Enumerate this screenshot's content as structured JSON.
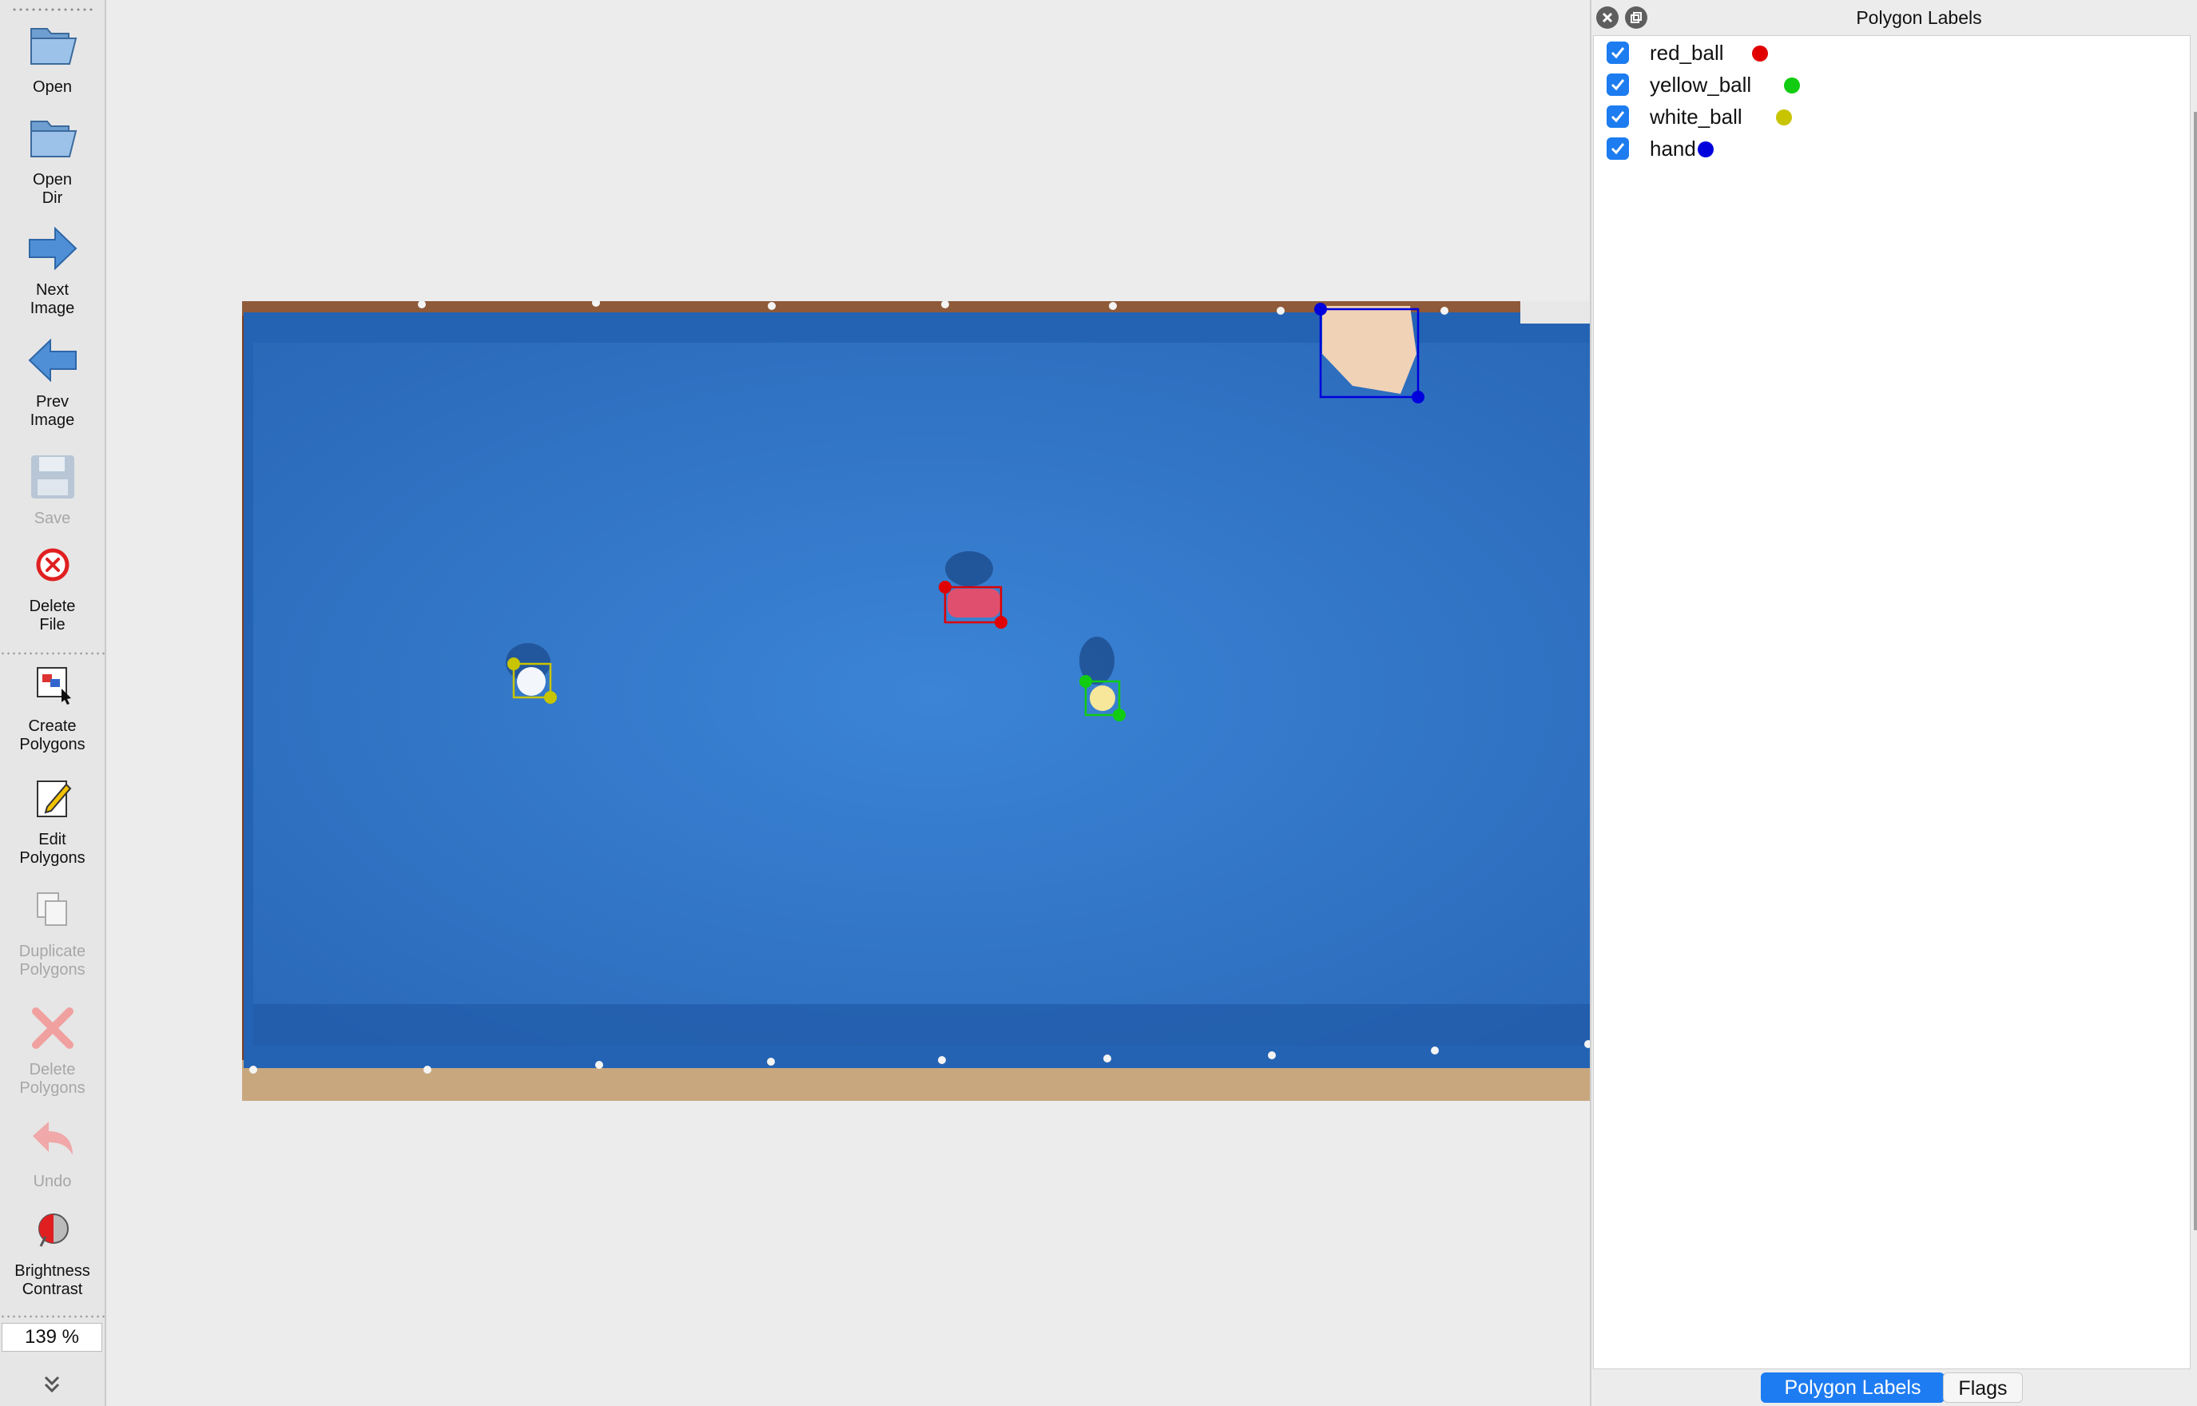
{
  "toolbar": {
    "items": [
      {
        "label": "Open",
        "icon": "folder-open-icon",
        "enabled": true
      },
      {
        "label": "Open\nDir",
        "icon": "folder-open-dir-icon",
        "enabled": true
      },
      {
        "label": "Next\nImage",
        "icon": "arrow-right-icon",
        "enabled": true
      },
      {
        "label": "Prev\nImage",
        "icon": "arrow-left-icon",
        "enabled": true
      },
      {
        "label": "Save",
        "icon": "floppy-disk-icon",
        "enabled": false
      },
      {
        "label": "Delete\nFile",
        "icon": "delete-circle-icon",
        "enabled": true
      },
      {
        "label": "Create\nPolygons",
        "icon": "create-polygon-icon",
        "enabled": true
      },
      {
        "label": "Edit\nPolygons",
        "icon": "edit-pencil-icon",
        "enabled": true
      },
      {
        "label": "Duplicate\nPolygons",
        "icon": "duplicate-icon",
        "enabled": false
      },
      {
        "label": "Delete\nPolygons",
        "icon": "delete-x-icon",
        "enabled": false
      },
      {
        "label": "Undo",
        "icon": "undo-arrow-icon",
        "enabled": false
      },
      {
        "label": "Brightness\nContrast",
        "icon": "brightness-contrast-icon",
        "enabled": true
      }
    ],
    "zoom": "139 %"
  },
  "dock": {
    "title": "Polygon Labels",
    "labels": [
      {
        "name": "red_ball",
        "color": "#e00000",
        "checked": true
      },
      {
        "name": "yellow_ball",
        "color": "#11cc11",
        "checked": true
      },
      {
        "name": "white_ball",
        "color": "#c8c400",
        "checked": true
      },
      {
        "name": "hand",
        "color": "#0000dd",
        "checked": true
      }
    ],
    "tabs": {
      "polygon_labels": "Polygon Labels",
      "flags": "Flags"
    }
  },
  "colors": {
    "felt": "#2f74c8",
    "rail": "#8b4a28",
    "accent": "#1e7cf2"
  }
}
